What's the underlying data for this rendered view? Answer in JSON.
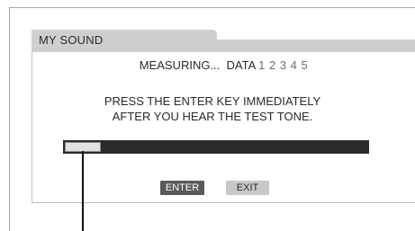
{
  "dialog": {
    "title": "MY SOUND",
    "status": {
      "label": "MEASURING...  DATA ",
      "steps": "1 2 3 4 5"
    },
    "instructions": "PRESS THE ENTER KEY IMMEDIATELY\nAFTER YOU HEAR THE TEST TONE.",
    "progress_fraction": 0.12,
    "buttons": {
      "enter_label": "ENTER",
      "exit_label": "EXIT"
    }
  },
  "colors": {
    "tab_background": "#cfcfcf",
    "progress_track": "#2b2b2b",
    "progress_fill": "#e2e2e2",
    "enter_button": "#5a5a5a",
    "exit_button": "#c8c8c8"
  }
}
